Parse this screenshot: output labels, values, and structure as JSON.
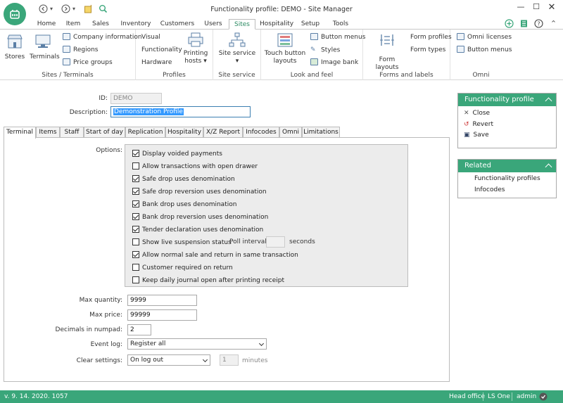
{
  "window": {
    "title": "Functionality profile: DEMO - Site Manager"
  },
  "menu": {
    "tabs": [
      "Home",
      "Item",
      "Sales",
      "Inventory",
      "Customers",
      "Users",
      "Sites",
      "Hospitality",
      "Setup",
      "Tools"
    ],
    "active": "Sites"
  },
  "ribbon": {
    "sites_terminals": {
      "label": "Sites / Terminals",
      "stores": "Stores",
      "terminals": "Terminals",
      "company_info": "Company information",
      "regions": "Regions",
      "price_groups": "Price groups"
    },
    "profiles": {
      "label": "Profiles",
      "visual": "Visual",
      "functionality": "Functionality",
      "hardware": "Hardware",
      "printing_hosts": "Printing hosts"
    },
    "site_service": {
      "label": "Site service",
      "site_service_btn": "Site service"
    },
    "look_and_feel": {
      "label": "Look and feel",
      "touch_buttons": "Touch button layouts",
      "button_menus": "Button menus",
      "styles": "Styles",
      "image_bank": "Image bank"
    },
    "forms_labels": {
      "label": "Forms and labels",
      "form_layouts": "Form layouts",
      "form_profiles": "Form profiles",
      "form_types": "Form types"
    },
    "omni": {
      "label": "Omni",
      "omni_licenses": "Omni licenses",
      "button_menus": "Button menus"
    }
  },
  "form": {
    "id_label": "ID:",
    "id_value": "DEMO",
    "desc_label": "Description:",
    "desc_value": "Demonstration Profile"
  },
  "tabs": [
    "Terminal",
    "Items",
    "Staff",
    "Start of day",
    "Replication",
    "Hospitality",
    "X/Z Report",
    "Infocodes",
    "Omni",
    "Limitations"
  ],
  "options": {
    "label": "Options:",
    "items": [
      {
        "text": "Display voided payments",
        "checked": true
      },
      {
        "text": "Allow transactions with open drawer",
        "checked": false
      },
      {
        "text": "Safe drop uses denomination",
        "checked": true
      },
      {
        "text": "Safe drop reversion uses denomination",
        "checked": true
      },
      {
        "text": "Bank drop uses denomination",
        "checked": true
      },
      {
        "text": "Bank drop reversion uses denomination",
        "checked": true
      },
      {
        "text": "Tender declaration uses denomination",
        "checked": true
      },
      {
        "text": "Show live suspension status",
        "checked": false
      },
      {
        "text": "Allow normal sale and return in same transaction",
        "checked": true
      },
      {
        "text": "Customer required on return",
        "checked": false
      },
      {
        "text": "Keep daily journal open after printing receipt",
        "checked": false
      }
    ],
    "poll_interval_label": "Poll interval",
    "poll_interval_value": "",
    "seconds_label": "seconds"
  },
  "fields": {
    "max_quantity_label": "Max quantity:",
    "max_quantity": "9999",
    "max_price_label": "Max price:",
    "max_price": "99999",
    "decimals_label": "Decimals in numpad:",
    "decimals": "2",
    "event_log_label": "Event log:",
    "event_log": "Register all",
    "clear_settings_label": "Clear settings:",
    "clear_settings": "On log out",
    "minutes_value": "1",
    "minutes_label": "minutes"
  },
  "panel_functionality": {
    "title": "Functionality profile",
    "close": "Close",
    "revert": "Revert",
    "save": "Save"
  },
  "panel_related": {
    "title": "Related",
    "items": [
      "Functionality profiles",
      "Infocodes"
    ]
  },
  "status": {
    "version": "v. 9. 14. 2020. 1057",
    "store": "Head office",
    "product": "LS One",
    "user": "admin"
  },
  "colors": {
    "accent": "#3aa67a",
    "selection": "#3399ff"
  }
}
